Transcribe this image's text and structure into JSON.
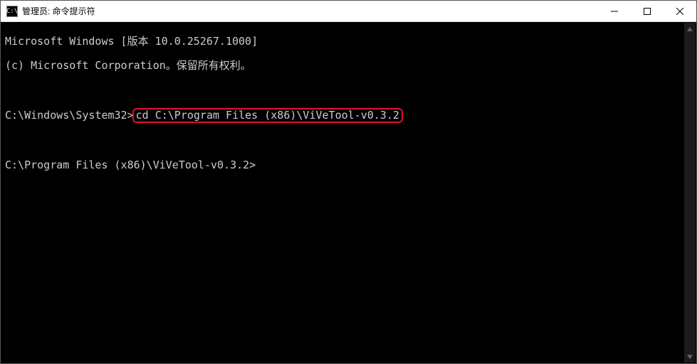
{
  "titlebar": {
    "icon_label": "C:\\",
    "title": "管理员: 命令提示符"
  },
  "terminal": {
    "line1": "Microsoft Windows [版本 10.0.25267.1000]",
    "line2": "(c) Microsoft Corporation。保留所有权利。",
    "blank1": " ",
    "prompt1_path": "C:\\Windows\\System32>",
    "prompt1_cmd": "cd C:\\Program Files (x86)\\ViVeTool-v0.3.2",
    "blank2": " ",
    "prompt2": "C:\\Program Files (x86)\\ViVeTool-v0.3.2>"
  },
  "highlight_color": "#e30d2d"
}
